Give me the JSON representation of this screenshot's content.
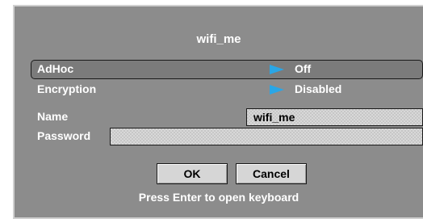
{
  "dialog": {
    "title": "wifi_me",
    "rows": {
      "adhoc": {
        "label": "AdHoc",
        "value": "Off"
      },
      "encryption": {
        "label": "Encryption",
        "value": "Disabled"
      },
      "name": {
        "label": "Name",
        "value": "wifi_me"
      },
      "password": {
        "label": "Password",
        "value": ""
      }
    },
    "buttons": {
      "ok": "OK",
      "cancel": "Cancel"
    },
    "hint": "Press Enter to open keyboard"
  },
  "colors": {
    "panel": "#8c8c8c",
    "selected_row": "#7b7b7b",
    "arrow": "#2aa6e6",
    "input_bg": "#d8d8d8",
    "button_bg": "#d6d6d6"
  }
}
